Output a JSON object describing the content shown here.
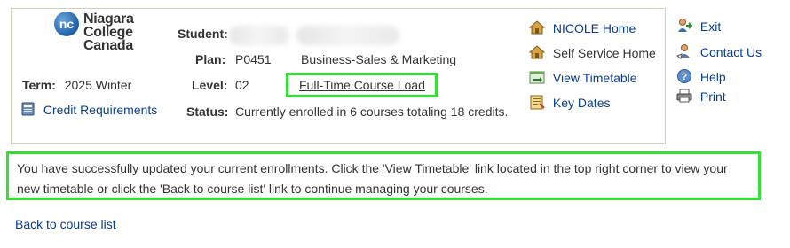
{
  "logo": {
    "initials": "nc",
    "line1": "Niagara",
    "line2": "College",
    "line3": "Canada"
  },
  "term": {
    "label": "Term:",
    "value": "2025 Winter"
  },
  "credit_requirements": {
    "label": "Credit Requirements"
  },
  "student": {
    "label": "Student:"
  },
  "plan": {
    "label": "Plan:",
    "code": "P0451",
    "name": "Business-Sales & Marketing"
  },
  "level": {
    "label": "Level:",
    "value": "02",
    "course_load": "Full-Time Course Load"
  },
  "status": {
    "label": "Status:",
    "value": "Currently enrolled in 6 courses totaling 18 credits."
  },
  "nav_links": [
    {
      "label": "NICOLE Home",
      "icon": "home-icon"
    },
    {
      "label": "Self Service Home",
      "icon": "home-icon"
    },
    {
      "label": "View Timetable",
      "icon": "timetable-icon"
    },
    {
      "label": "Key Dates",
      "icon": "calendar-icon"
    }
  ],
  "side_links": [
    {
      "label": "Exit",
      "icon": "exit-icon"
    },
    {
      "label": "Contact Us",
      "icon": "contact-icon"
    },
    {
      "label": "Help",
      "icon": "help-icon"
    },
    {
      "label": "Print",
      "icon": "print-icon"
    }
  ],
  "message": "You have successfully updated your current enrollments. Click the 'View Timetable' link located in the top right corner to view your new timetable or click the 'Back to course list' link to continue managing your courses.",
  "back_link": "Back to course list",
  "colors": {
    "highlight": "#33e033",
    "link": "#0b3d91",
    "box_border": "#d4d4b4"
  }
}
